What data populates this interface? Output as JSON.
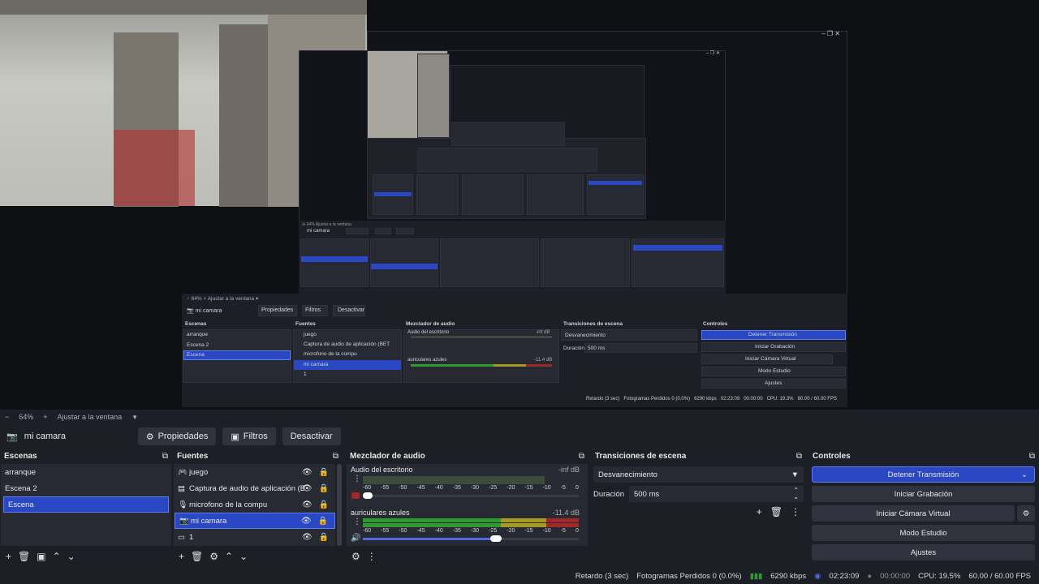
{
  "window": {
    "minimize_icon": "minimize-icon",
    "maximize_icon": "restore-icon",
    "close_icon": "close-icon"
  },
  "nested": {
    "zoom": "64%",
    "fit": "Ajustar a la ventana",
    "source_name": "mi camara",
    "properties": "Propiedades",
    "filters": "Filtros",
    "deactivate": "Desactivar",
    "scenes_title": "Escenas",
    "sources_title": "Fuentes",
    "mixer_title": "Mezclador de audio",
    "transitions_title": "Transiciones de escena",
    "controls_title": "Controles",
    "scenes": [
      "arranque",
      "Escena 2",
      "Escena"
    ],
    "sources": [
      "juego",
      "Captura de audio de aplicación (BET",
      "microfono de la compu",
      "mi camara",
      "1"
    ],
    "mixer": [
      {
        "name": "Audio del escritorio",
        "db": "-inf dB"
      },
      {
        "name": "auriculares azules",
        "db": "-11.4 dB"
      }
    ],
    "transition": "Desvanecimiento",
    "duration_label": "Duración",
    "duration": "500 ms",
    "controls": [
      "Detener Transmisión",
      "Iniciar Grabación",
      "Iniciar Cámara Virtual",
      "Modo Estudio",
      "Ajustes"
    ],
    "status": {
      "delay": "Retardo (3 sec)",
      "dropped": "Fotogramas Perdidos 0 (0.0%)",
      "kbps": "6290 kbps",
      "time": "02:23:09",
      "rec": "00:00:00",
      "cpu": "CPU: 19.3%",
      "fps": "60.00 / 60.00 FPS"
    }
  },
  "zoombar": {
    "minus": "−",
    "zoom": "64%",
    "plus": "+",
    "fit": "Ajustar a la ventana",
    "chevron_icon": "chevron-down-icon"
  },
  "sourcebar": {
    "camera_icon": "camera-icon",
    "source_name": "mi camara",
    "properties": "Propiedades",
    "filters": "Filtros",
    "deactivate": "Desactivar"
  },
  "scenes": {
    "title": "Escenas",
    "items": [
      "arranque",
      "Escena 2",
      "Escena"
    ],
    "selected": 2
  },
  "sources": {
    "title": "Fuentes",
    "items": [
      {
        "icon": "gamepad-icon",
        "label": "juego"
      },
      {
        "icon": "audio-capture-icon",
        "label": "Captura de audio de aplicación (BET"
      },
      {
        "icon": "microphone-icon",
        "label": "microfono de la compu"
      },
      {
        "icon": "camera-icon",
        "label": "mi camara"
      },
      {
        "icon": "display-icon",
        "label": "1"
      }
    ],
    "selected": 3
  },
  "mixer": {
    "title": "Mezclador de audio",
    "channels": [
      {
        "name": "Audio del escritorio",
        "db": "-inf dB",
        "level": 0.0,
        "volume": 0.03,
        "muted": true
      },
      {
        "name": "auriculares azules",
        "db": "-11.4 dB",
        "level": 0.72,
        "volume": 0.62,
        "muted": false
      }
    ],
    "scale": [
      "-60",
      "-55",
      "-50",
      "-45",
      "-40",
      "-35",
      "-30",
      "-25",
      "-20",
      "-15",
      "-10",
      "-5",
      "0"
    ]
  },
  "transitions": {
    "title": "Transiciones de escena",
    "selected": "Desvanecimiento",
    "duration_label": "Duración",
    "duration": "500 ms"
  },
  "controls": {
    "title": "Controles",
    "stream": "Detener Transmisión",
    "record": "Iniciar Grabación",
    "virtualcam": "Iniciar Cámara Virtual",
    "studio": "Modo Estudio",
    "settings": "Ajustes"
  },
  "status": {
    "delay": "Retardo (3 sec)",
    "dropped": "Fotogramas Perdidos 0 (0.0%)",
    "kbps": "6290 kbps",
    "time": "02:23:09",
    "rec": "00:00:00",
    "cpu": "CPU: 19.5%",
    "fps": "60.00 / 60.00 FPS"
  },
  "colors": {
    "accent": "#2b48c4",
    "bg": "#1d1f26",
    "panel": "#272a33",
    "meter_green": "#2f9a2f",
    "meter_yellow": "#a69a1f",
    "meter_red": "#a22828"
  }
}
